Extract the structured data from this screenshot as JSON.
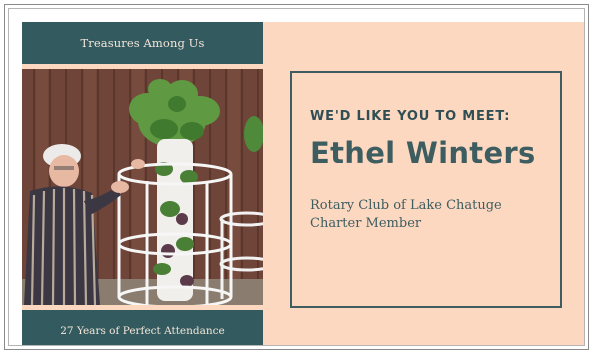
{
  "card": {
    "header": "Treasures Among Us",
    "footer": "27 Years of Perfect Attendance",
    "intro": "WE'D LIKE YOU TO MEET:",
    "name": "Ethel Winters",
    "description_line1": "Rotary Club of Lake Chatuge",
    "description_line2": "Charter Member"
  },
  "colors": {
    "panel_teal": "#335a5f",
    "background_peach": "#fdd8c1",
    "text_teal": "#3d5d60"
  }
}
